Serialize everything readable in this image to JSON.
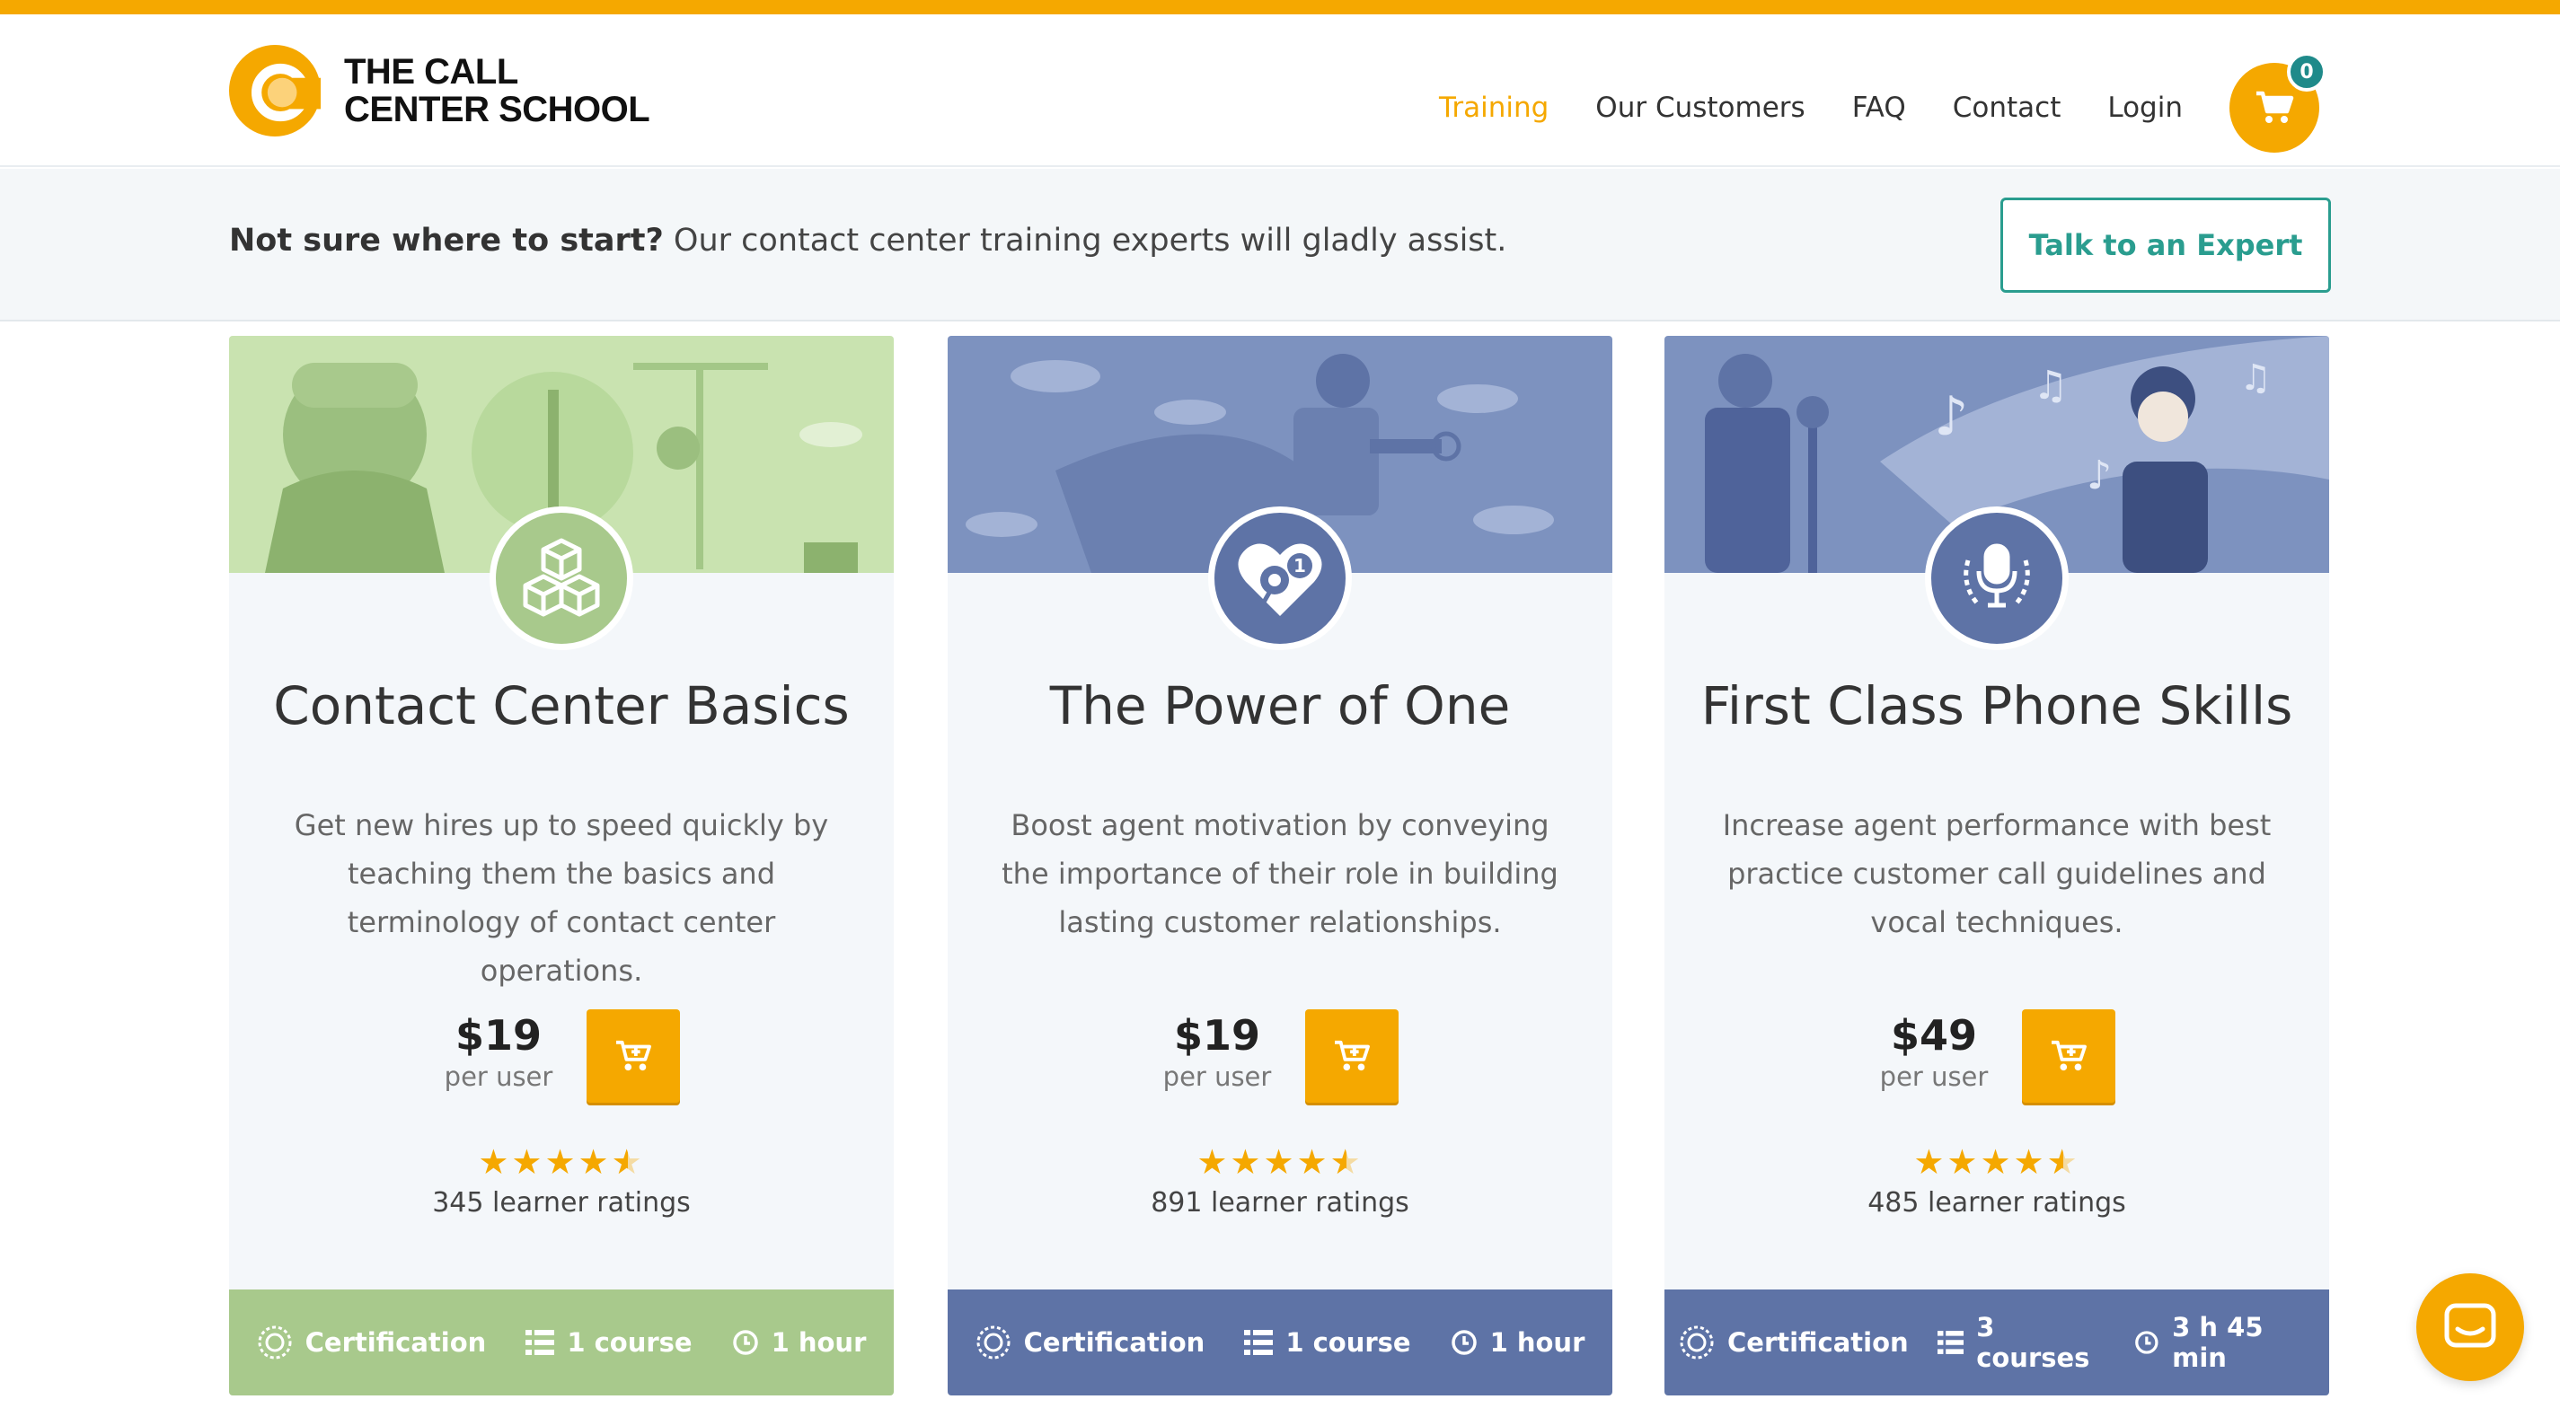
{
  "brand": {
    "name_line1": "THE CALL",
    "name_line2": "CENTER SCHOOL",
    "accent": "#f5a800",
    "teal": "#2a9d8f"
  },
  "nav": {
    "items": [
      {
        "label": "Training",
        "active": true
      },
      {
        "label": "Our Customers"
      },
      {
        "label": "FAQ"
      },
      {
        "label": "Contact"
      },
      {
        "label": "Login"
      }
    ],
    "cart_count": "0"
  },
  "assist": {
    "bold": "Not sure where to start?",
    "text": " Our contact center training experts will gladly assist.",
    "button": "Talk to an Expert"
  },
  "cards": [
    {
      "title": "Contact Center Basics",
      "description": "Get new hires up to speed quickly by teaching them the basics and terminology of contact center operations.",
      "price": "$19",
      "per": "per user",
      "rating": 4.5,
      "ratings_text": "345 learner ratings",
      "footer": {
        "cert": "Certification",
        "courses": "1 course",
        "duration": "1 hour"
      },
      "color": "#a8c98c",
      "banner_color": "#c9e3b0"
    },
    {
      "title": "The Power of One",
      "description": "Boost agent motivation by conveying the importance of their role in building lasting customer relationships.",
      "price": "$19",
      "per": "per user",
      "rating": 4.5,
      "ratings_text": "891 learner ratings",
      "footer": {
        "cert": "Certification",
        "courses": "1 course",
        "duration": "1 hour"
      },
      "color": "#5e73a6",
      "banner_color": "#7d92bf"
    },
    {
      "title": "First Class Phone Skills",
      "description": "Increase agent performance with best practice customer call guidelines and vocal techniques.",
      "price": "$49",
      "per": "per user",
      "rating": 4.5,
      "ratings_text": "485 learner ratings",
      "footer": {
        "cert": "Certification",
        "courses": "3 courses",
        "duration": "3 h 45 min"
      },
      "color": "#5e73a6",
      "banner_color": "#7d92bf"
    }
  ]
}
